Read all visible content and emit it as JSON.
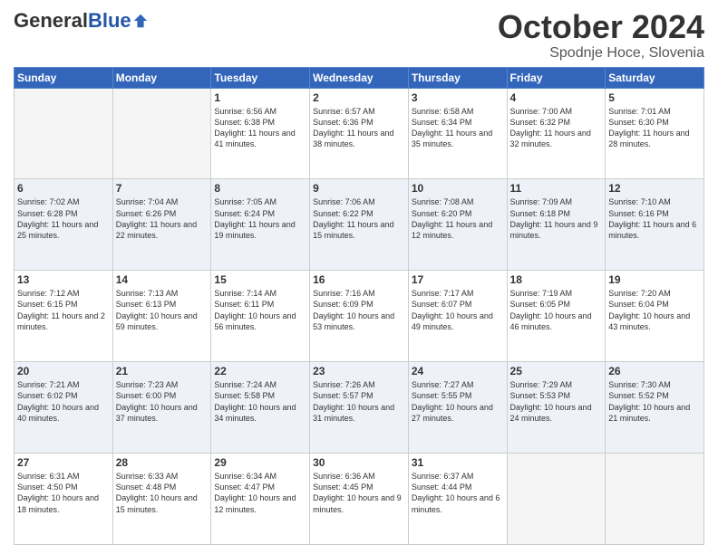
{
  "header": {
    "logo_general": "General",
    "logo_blue": "Blue",
    "month": "October 2024",
    "location": "Spodnje Hoce, Slovenia"
  },
  "weekdays": [
    "Sunday",
    "Monday",
    "Tuesday",
    "Wednesday",
    "Thursday",
    "Friday",
    "Saturday"
  ],
  "weeks": [
    [
      {
        "day": "",
        "empty": true
      },
      {
        "day": "",
        "empty": true
      },
      {
        "day": "1",
        "sunrise": "Sunrise: 6:56 AM",
        "sunset": "Sunset: 6:38 PM",
        "daylight": "Daylight: 11 hours and 41 minutes."
      },
      {
        "day": "2",
        "sunrise": "Sunrise: 6:57 AM",
        "sunset": "Sunset: 6:36 PM",
        "daylight": "Daylight: 11 hours and 38 minutes."
      },
      {
        "day": "3",
        "sunrise": "Sunrise: 6:58 AM",
        "sunset": "Sunset: 6:34 PM",
        "daylight": "Daylight: 11 hours and 35 minutes."
      },
      {
        "day": "4",
        "sunrise": "Sunrise: 7:00 AM",
        "sunset": "Sunset: 6:32 PM",
        "daylight": "Daylight: 11 hours and 32 minutes."
      },
      {
        "day": "5",
        "sunrise": "Sunrise: 7:01 AM",
        "sunset": "Sunset: 6:30 PM",
        "daylight": "Daylight: 11 hours and 28 minutes."
      }
    ],
    [
      {
        "day": "6",
        "sunrise": "Sunrise: 7:02 AM",
        "sunset": "Sunset: 6:28 PM",
        "daylight": "Daylight: 11 hours and 25 minutes."
      },
      {
        "day": "7",
        "sunrise": "Sunrise: 7:04 AM",
        "sunset": "Sunset: 6:26 PM",
        "daylight": "Daylight: 11 hours and 22 minutes."
      },
      {
        "day": "8",
        "sunrise": "Sunrise: 7:05 AM",
        "sunset": "Sunset: 6:24 PM",
        "daylight": "Daylight: 11 hours and 19 minutes."
      },
      {
        "day": "9",
        "sunrise": "Sunrise: 7:06 AM",
        "sunset": "Sunset: 6:22 PM",
        "daylight": "Daylight: 11 hours and 15 minutes."
      },
      {
        "day": "10",
        "sunrise": "Sunrise: 7:08 AM",
        "sunset": "Sunset: 6:20 PM",
        "daylight": "Daylight: 11 hours and 12 minutes."
      },
      {
        "day": "11",
        "sunrise": "Sunrise: 7:09 AM",
        "sunset": "Sunset: 6:18 PM",
        "daylight": "Daylight: 11 hours and 9 minutes."
      },
      {
        "day": "12",
        "sunrise": "Sunrise: 7:10 AM",
        "sunset": "Sunset: 6:16 PM",
        "daylight": "Daylight: 11 hours and 6 minutes."
      }
    ],
    [
      {
        "day": "13",
        "sunrise": "Sunrise: 7:12 AM",
        "sunset": "Sunset: 6:15 PM",
        "daylight": "Daylight: 11 hours and 2 minutes."
      },
      {
        "day": "14",
        "sunrise": "Sunrise: 7:13 AM",
        "sunset": "Sunset: 6:13 PM",
        "daylight": "Daylight: 10 hours and 59 minutes."
      },
      {
        "day": "15",
        "sunrise": "Sunrise: 7:14 AM",
        "sunset": "Sunset: 6:11 PM",
        "daylight": "Daylight: 10 hours and 56 minutes."
      },
      {
        "day": "16",
        "sunrise": "Sunrise: 7:16 AM",
        "sunset": "Sunset: 6:09 PM",
        "daylight": "Daylight: 10 hours and 53 minutes."
      },
      {
        "day": "17",
        "sunrise": "Sunrise: 7:17 AM",
        "sunset": "Sunset: 6:07 PM",
        "daylight": "Daylight: 10 hours and 49 minutes."
      },
      {
        "day": "18",
        "sunrise": "Sunrise: 7:19 AM",
        "sunset": "Sunset: 6:05 PM",
        "daylight": "Daylight: 10 hours and 46 minutes."
      },
      {
        "day": "19",
        "sunrise": "Sunrise: 7:20 AM",
        "sunset": "Sunset: 6:04 PM",
        "daylight": "Daylight: 10 hours and 43 minutes."
      }
    ],
    [
      {
        "day": "20",
        "sunrise": "Sunrise: 7:21 AM",
        "sunset": "Sunset: 6:02 PM",
        "daylight": "Daylight: 10 hours and 40 minutes."
      },
      {
        "day": "21",
        "sunrise": "Sunrise: 7:23 AM",
        "sunset": "Sunset: 6:00 PM",
        "daylight": "Daylight: 10 hours and 37 minutes."
      },
      {
        "day": "22",
        "sunrise": "Sunrise: 7:24 AM",
        "sunset": "Sunset: 5:58 PM",
        "daylight": "Daylight: 10 hours and 34 minutes."
      },
      {
        "day": "23",
        "sunrise": "Sunrise: 7:26 AM",
        "sunset": "Sunset: 5:57 PM",
        "daylight": "Daylight: 10 hours and 31 minutes."
      },
      {
        "day": "24",
        "sunrise": "Sunrise: 7:27 AM",
        "sunset": "Sunset: 5:55 PM",
        "daylight": "Daylight: 10 hours and 27 minutes."
      },
      {
        "day": "25",
        "sunrise": "Sunrise: 7:29 AM",
        "sunset": "Sunset: 5:53 PM",
        "daylight": "Daylight: 10 hours and 24 minutes."
      },
      {
        "day": "26",
        "sunrise": "Sunrise: 7:30 AM",
        "sunset": "Sunset: 5:52 PM",
        "daylight": "Daylight: 10 hours and 21 minutes."
      }
    ],
    [
      {
        "day": "27",
        "sunrise": "Sunrise: 6:31 AM",
        "sunset": "Sunset: 4:50 PM",
        "daylight": "Daylight: 10 hours and 18 minutes."
      },
      {
        "day": "28",
        "sunrise": "Sunrise: 6:33 AM",
        "sunset": "Sunset: 4:48 PM",
        "daylight": "Daylight: 10 hours and 15 minutes."
      },
      {
        "day": "29",
        "sunrise": "Sunrise: 6:34 AM",
        "sunset": "Sunset: 4:47 PM",
        "daylight": "Daylight: 10 hours and 12 minutes."
      },
      {
        "day": "30",
        "sunrise": "Sunrise: 6:36 AM",
        "sunset": "Sunset: 4:45 PM",
        "daylight": "Daylight: 10 hours and 9 minutes."
      },
      {
        "day": "31",
        "sunrise": "Sunrise: 6:37 AM",
        "sunset": "Sunset: 4:44 PM",
        "daylight": "Daylight: 10 hours and 6 minutes."
      },
      {
        "day": "",
        "empty": true
      },
      {
        "day": "",
        "empty": true
      }
    ]
  ]
}
